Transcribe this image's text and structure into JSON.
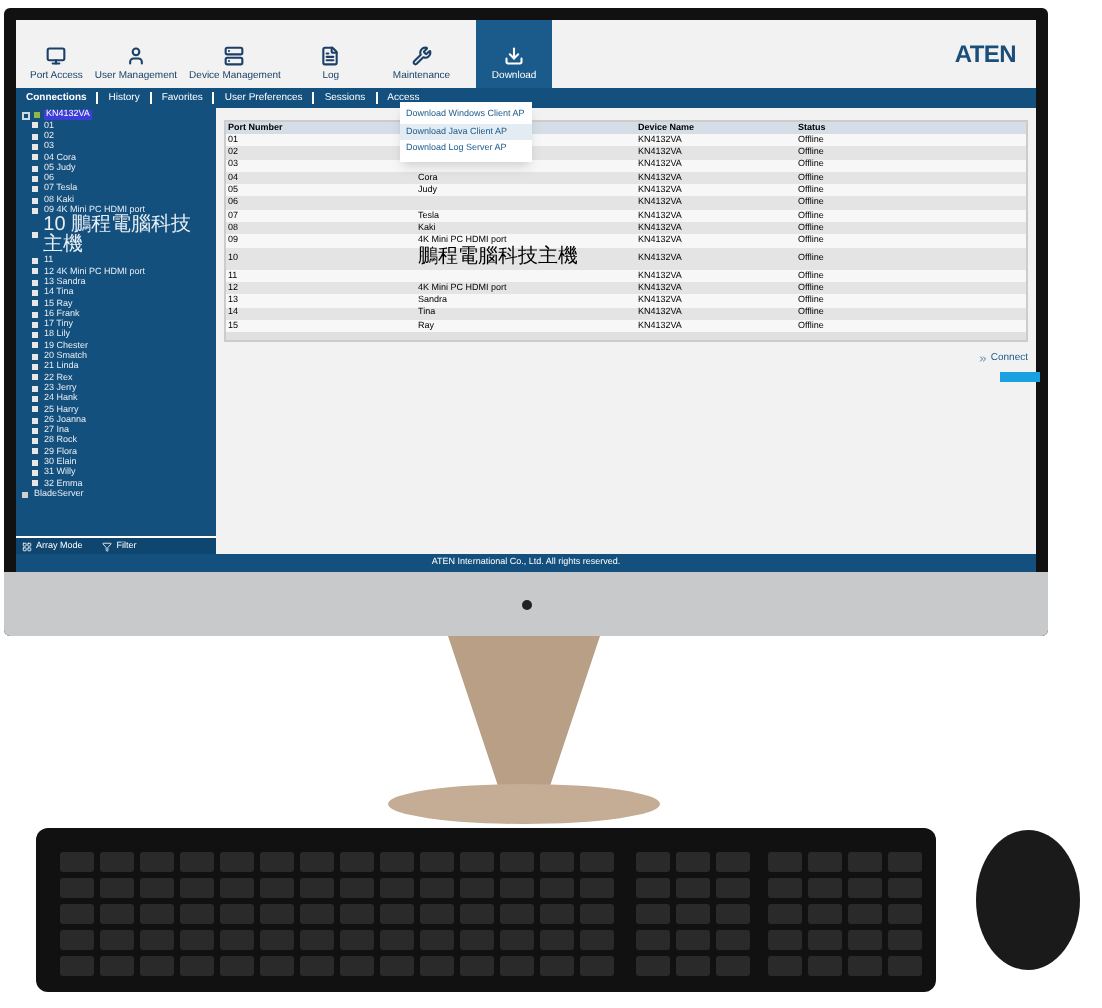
{
  "toolbar": [
    {
      "label": "Port Access",
      "selected": false
    },
    {
      "label": "User Management",
      "selected": false
    },
    {
      "label": "Device Management",
      "selected": false
    },
    {
      "label": "Log",
      "selected": false
    },
    {
      "label": "Maintenance",
      "selected": false
    },
    {
      "label": "Download",
      "selected": true
    }
  ],
  "logo": "ATEN",
  "tabs": [
    {
      "label": "Connections",
      "selected": true
    },
    {
      "label": "History",
      "selected": false
    },
    {
      "label": "Favorites",
      "selected": false
    },
    {
      "label": "User Preferences",
      "selected": false
    },
    {
      "label": "Sessions",
      "selected": false
    },
    {
      "label": "Access",
      "selected": false
    }
  ],
  "download_menu": [
    {
      "label": "Download Windows Client AP",
      "selected": false
    },
    {
      "label": "Download Java Client AP",
      "selected": true
    },
    {
      "label": "Download Log Server AP",
      "selected": false
    }
  ],
  "sidebar": {
    "tree": [
      {
        "label": "KN4132VA",
        "kind": "device",
        "selected": true,
        "expanded": true,
        "children": [
          {
            "label": "01",
            "kind": "port",
            "selected": false
          },
          {
            "label": "02",
            "kind": "port",
            "selected": false
          },
          {
            "label": "03",
            "kind": "port",
            "selected": false
          },
          {
            "label": "04 Cora",
            "kind": "port",
            "selected": false
          },
          {
            "label": "05 Judy",
            "kind": "port",
            "selected": false
          },
          {
            "label": "06",
            "kind": "port",
            "selected": false
          },
          {
            "label": "07 Tesla",
            "kind": "port",
            "selected": false
          },
          {
            "label": "08 Kaki",
            "kind": "port",
            "selected": false
          },
          {
            "label": "09 4K Mini PC HDMI port",
            "kind": "port",
            "selected": false
          },
          {
            "label": "10 鵬程電腦科技主機",
            "kind": "port",
            "selected": false
          },
          {
            "label": "11",
            "kind": "port",
            "selected": false
          },
          {
            "label": "12 4K Mini PC HDMI port",
            "kind": "port",
            "selected": false
          },
          {
            "label": "13 Sandra",
            "kind": "port",
            "selected": false
          },
          {
            "label": "14 Tina",
            "kind": "port",
            "selected": false
          },
          {
            "label": "15 Ray",
            "kind": "port",
            "selected": false
          },
          {
            "label": "16 Frank",
            "kind": "port",
            "selected": false
          },
          {
            "label": "17 Tiny",
            "kind": "port",
            "selected": false
          },
          {
            "label": "18 Lily",
            "kind": "port",
            "selected": false
          },
          {
            "label": "19 Chester",
            "kind": "port",
            "selected": false
          },
          {
            "label": "20 Smatch",
            "kind": "port",
            "selected": false
          },
          {
            "label": "21 Linda",
            "kind": "port",
            "selected": false
          },
          {
            "label": "22 Rex",
            "kind": "port",
            "selected": false
          },
          {
            "label": "23 Jerry",
            "kind": "port",
            "selected": false
          },
          {
            "label": "24 Hank",
            "kind": "port",
            "selected": false
          },
          {
            "label": "25 Harry",
            "kind": "port",
            "selected": false
          },
          {
            "label": "26 Joanna",
            "kind": "port",
            "selected": false
          },
          {
            "label": "27 Ina",
            "kind": "port",
            "selected": false
          },
          {
            "label": "28 Rock",
            "kind": "port",
            "selected": false
          },
          {
            "label": "29 Flora",
            "kind": "port",
            "selected": false
          },
          {
            "label": "30 Elain",
            "kind": "port",
            "selected": false
          },
          {
            "label": "31 Willy",
            "kind": "port",
            "selected": false
          },
          {
            "label": "32 Emma",
            "kind": "port",
            "selected": false
          }
        ]
      },
      {
        "label": "BladeServer",
        "kind": "blade",
        "selected": false
      }
    ],
    "buttons": [
      "Array Mode",
      "Filter"
    ]
  },
  "table": {
    "columns": {
      "port_number": "Port Number",
      "device_name": "Device Name",
      "status": "Status"
    },
    "rows": [
      {
        "port_number": "01",
        "device_name": "KN4132VA",
        "status": "Offline"
      },
      {
        "port_number": "02",
        "device_name": "KN4132VA",
        "status": "Offline"
      },
      {
        "port_number": "03",
        "device_name": "KN4132VA",
        "status": "Offline"
      },
      {
        "port_number": "04",
        "column_2": "Cora",
        "device_name": "KN4132VA",
        "status": "Offline"
      },
      {
        "port_number": "05",
        "column_2": "Judy",
        "device_name": "KN4132VA",
        "status": "Offline"
      },
      {
        "port_number": "06",
        "device_name": "KN4132VA",
        "status": "Offline"
      },
      {
        "port_number": "07",
        "column_2": "Tesla",
        "device_name": "KN4132VA",
        "status": "Offline"
      },
      {
        "port_number": "08",
        "column_2": "Kaki",
        "device_name": "KN4132VA",
        "status": "Offline"
      },
      {
        "port_number": "09",
        "column_2": "4K Mini PC HDMI port",
        "device_name": "KN4132VA",
        "status": "Offline"
      },
      {
        "port_number": "10",
        "column_2": "鵬程電腦科技主機",
        "device_name": "KN4132VA",
        "status": "Offline"
      },
      {
        "port_number": "11",
        "device_name": "KN4132VA",
        "status": "Offline"
      },
      {
        "port_number": "12",
        "column_2": "4K Mini PC HDMI port",
        "device_name": "KN4132VA",
        "status": "Offline"
      },
      {
        "port_number": "13",
        "column_2": "Sandra",
        "device_name": "KN4132VA",
        "status": "Offline"
      },
      {
        "port_number": "14",
        "column_2": "Tina",
        "device_name": "KN4132VA",
        "status": "Offline"
      },
      {
        "port_number": "15",
        "column_2": "Ray",
        "device_name": "KN4132VA",
        "status": "Offline"
      }
    ]
  },
  "connect_button": "Connect",
  "footer": "ATEN International Co., Ltd. All rights reserved."
}
